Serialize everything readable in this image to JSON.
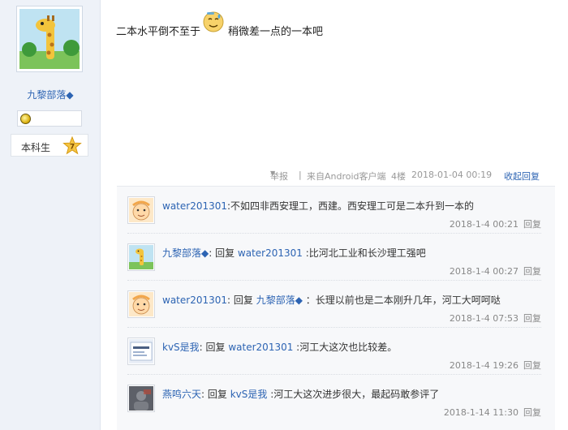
{
  "user": {
    "name": "九黎部落◆",
    "rank": "本科生",
    "rank_level": "7",
    "medal_icon": "gold-medal-icon",
    "avatar_icon": "giraffe-avatar-icon"
  },
  "post": {
    "text_before": "二本水平倒不至于",
    "emoji_icon": "sweat-smile-icon",
    "text_after": "稍微差一点的一本吧",
    "report_label": "举报",
    "separator": "|",
    "client": "来自Android客户端",
    "floor": "4楼",
    "datetime": "2018-01-04 00:19",
    "collapse_label": "收起回复"
  },
  "replies": [
    {
      "author": "water201301",
      "pre": ":",
      "reply_to": "",
      "content": "不如四非西安理工，西建。西安理工可是二本升到一本的",
      "time": "2018-1-4 00:21",
      "action": "回复",
      "avatar_icon": "cartoon-face-avatar-icon"
    },
    {
      "author": "九黎部落◆",
      "pre": ": 回复 ",
      "reply_to": "water201301",
      "content": " :比河北工业和长沙理工强吧",
      "time": "2018-1-4 00:27",
      "action": "回复",
      "avatar_icon": "giraffe-avatar-icon"
    },
    {
      "author": "water201301",
      "pre": ": 回复 ",
      "reply_to": "九黎部落◆",
      "content": " ：长理以前也是二本刚升几年，河工大呵呵哒",
      "time": "2018-1-4 07:53",
      "action": "回复",
      "avatar_icon": "cartoon-face-avatar-icon"
    },
    {
      "author": "kvS是我",
      "pre": ": 回复 ",
      "reply_to": "water201301",
      "content": " :河工大这次也比较差。",
      "time": "2018-1-4 19:26",
      "action": "回复",
      "avatar_icon": "text-card-avatar-icon"
    },
    {
      "author": "燕鸣六天",
      "pre": ": 回复 ",
      "reply_to": "kvS是我",
      "content": " :河工大这次进步很大，最起码敢参评了",
      "time": "2018-1-14 11:30",
      "action": "回复",
      "avatar_icon": "dark-photo-avatar-icon"
    }
  ]
}
